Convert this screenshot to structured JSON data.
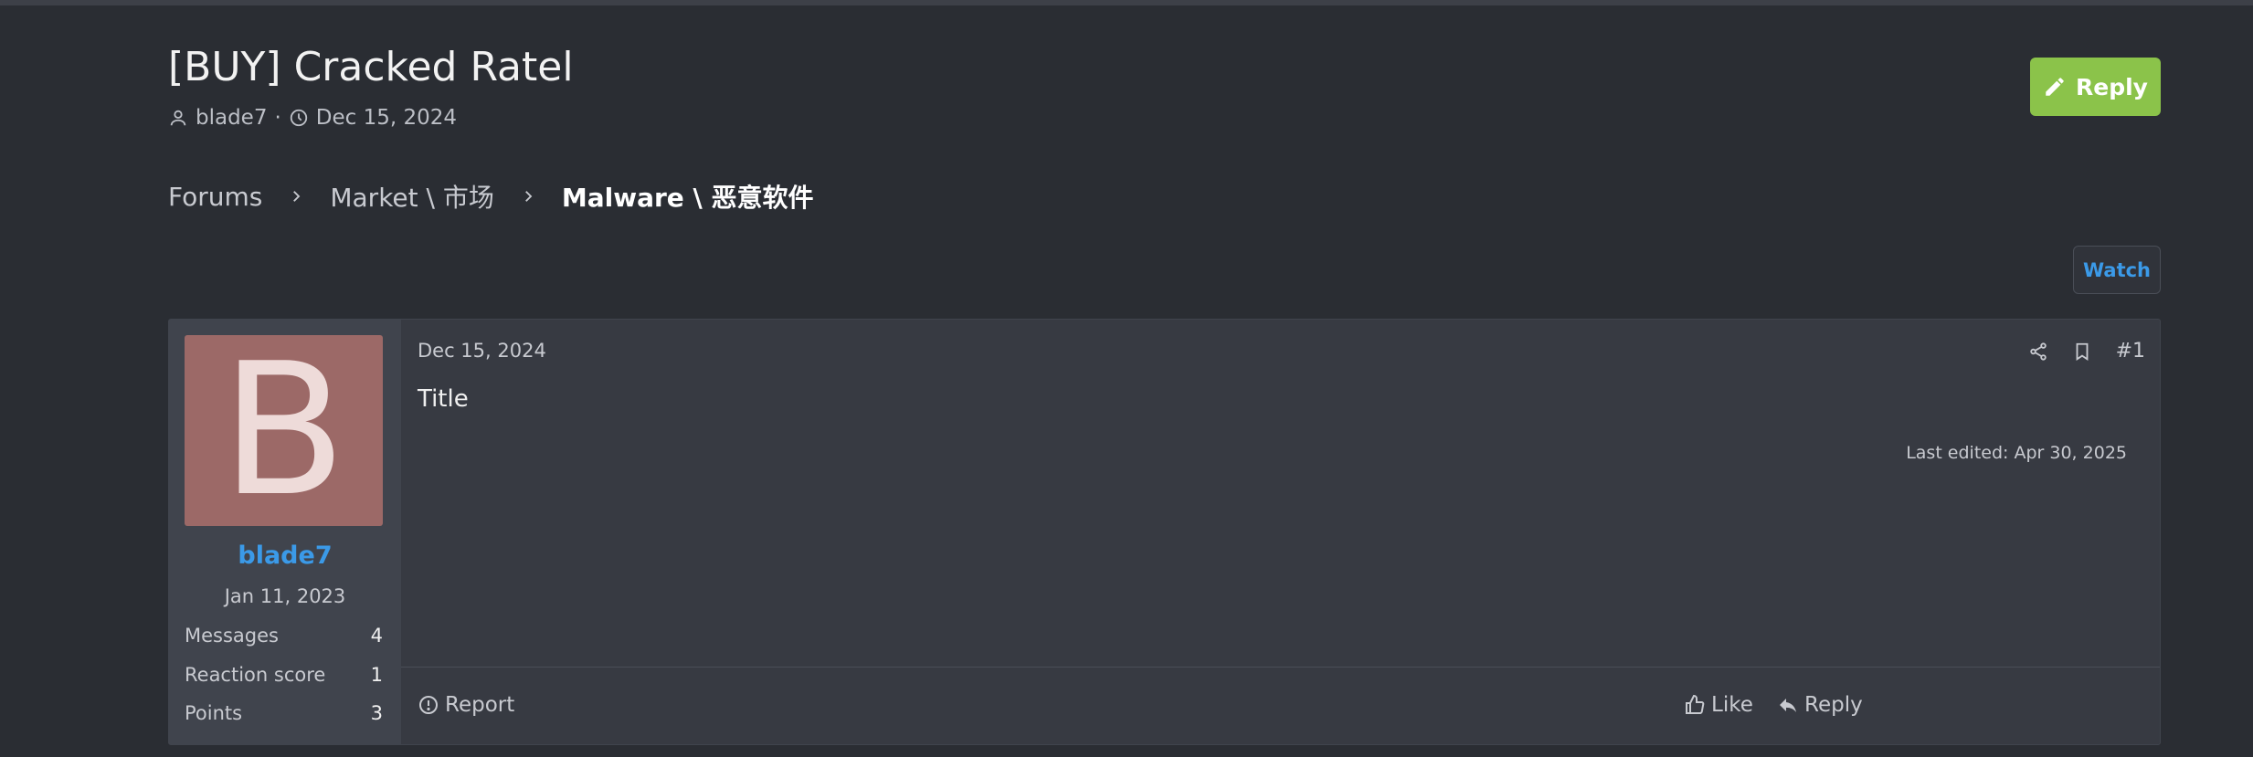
{
  "thread": {
    "title": "[BUY] Cracked Ratel",
    "author": "blade7",
    "separator": "·",
    "date": "Dec 15, 2024"
  },
  "header": {
    "reply_label": "Reply",
    "watch_label": "Watch"
  },
  "breadcrumb": {
    "items": [
      "Forums",
      "Market \\ 市场"
    ],
    "current": "Malware \\ 恶意软件"
  },
  "post": {
    "date": "Dec 15, 2024",
    "number": "#1",
    "body": "Title",
    "last_edited": "Last edited: Apr 30, 2025",
    "report_label": "Report",
    "like_label": "Like",
    "reply_label": "Reply"
  },
  "user": {
    "avatar_letter": "B",
    "name": "blade7",
    "joined": "Jan 11, 2023",
    "stats": [
      {
        "label": "Messages",
        "value": "4"
      },
      {
        "label": "Reaction score",
        "value": "1"
      },
      {
        "label": "Points",
        "value": "3"
      }
    ]
  },
  "colors": {
    "background": "#2a2d33",
    "post_bg": "#373a42",
    "accent_blue": "#3b9ae8",
    "reply_green": "#8bc34a",
    "avatar_bg": "#9c6967"
  },
  "icons": [
    "user-icon",
    "clock-icon",
    "pencil-icon",
    "chevron-right-icon",
    "share-icon",
    "bookmark-icon",
    "alert-circle-icon",
    "thumbs-up-icon",
    "reply-arrow-icon"
  ]
}
